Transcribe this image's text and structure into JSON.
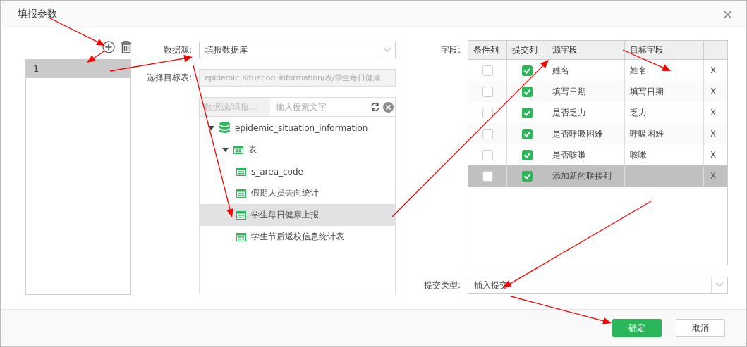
{
  "dialog": {
    "title": "填报参数",
    "close": "×"
  },
  "param_list": {
    "items": [
      {
        "label": "1",
        "selected": true
      }
    ]
  },
  "datasource": {
    "label": "数据源:",
    "value": "填报数据库"
  },
  "target_table": {
    "label": "选择目标表:",
    "value": "epidemic_situation_information/表/学生每日健康"
  },
  "tree": {
    "path_placeholder": "数据源/填报...",
    "search_placeholder": "输入搜索文字",
    "nodes": [
      {
        "label": "epidemic_situation_information",
        "kind": "database",
        "expanded": true,
        "selected": false,
        "children": [
          {
            "label": "表",
            "kind": "folder",
            "expanded": true,
            "selected": false,
            "children": [
              {
                "label": "s_area_code",
                "kind": "table",
                "selected": false
              },
              {
                "label": "假期人员去向统计",
                "kind": "table",
                "selected": false
              },
              {
                "label": "学生每日健康上报",
                "kind": "table",
                "selected": true
              },
              {
                "label": "学生节后返校信息统计表",
                "kind": "table",
                "selected": false
              }
            ]
          }
        ]
      }
    ]
  },
  "fields": {
    "label": "字段:",
    "columns": [
      "条件列",
      "提交列",
      "源字段",
      "目标字段"
    ],
    "rows": [
      {
        "condition": false,
        "submit": true,
        "source": "姓名",
        "target": "姓名",
        "remove": "X",
        "selected": false
      },
      {
        "condition": false,
        "submit": true,
        "source": "填写日期",
        "target": "填写日期",
        "remove": "X",
        "selected": false
      },
      {
        "condition": false,
        "submit": true,
        "source": "是否乏力",
        "target": "乏力",
        "remove": "X",
        "selected": false
      },
      {
        "condition": false,
        "submit": true,
        "source": "是否呼吸困难",
        "target": "呼吸困难",
        "remove": "X",
        "selected": false
      },
      {
        "condition": false,
        "submit": true,
        "source": "是否咳嗽",
        "target": "咳嗽",
        "remove": "X",
        "selected": false
      },
      {
        "condition": false,
        "submit": true,
        "source": "添加新的联接列",
        "remove": "X",
        "selected": true
      }
    ]
  },
  "submit_type": {
    "label": "提交类型:",
    "value": "插入提交"
  },
  "buttons": [
    {
      "label": "确定",
      "kind": "primary"
    },
    {
      "label": "取消",
      "kind": "secondary"
    }
  ]
}
